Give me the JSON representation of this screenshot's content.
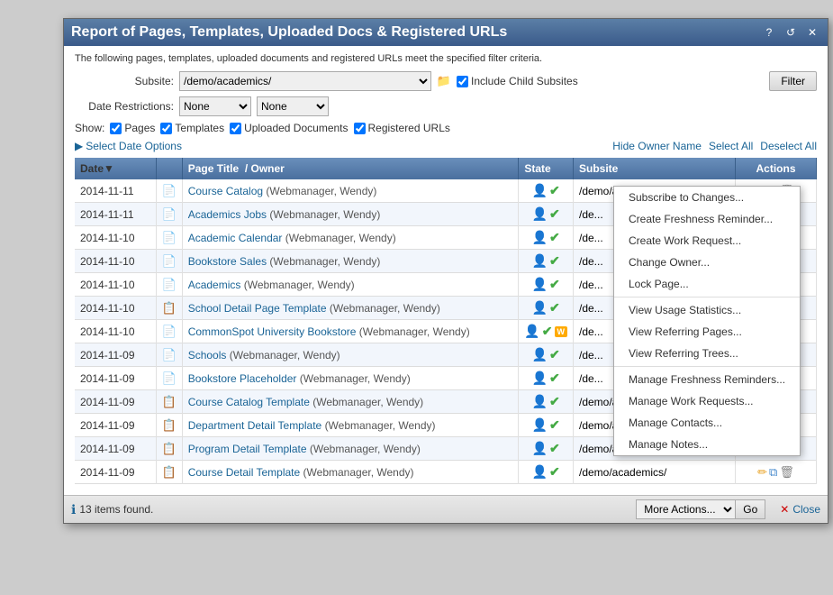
{
  "dialog": {
    "title": "Report of Pages, Templates, Uploaded Docs & Registered URLs",
    "subtitle": "The following pages, templates, uploaded documents and registered URLs meet the specified filter criteria.",
    "controls": {
      "help": "?",
      "refresh": "↺",
      "close": "✕"
    }
  },
  "form": {
    "subsite_label": "Subsite:",
    "subsite_value": "/demo/academics/",
    "date_restrictions_label": "Date Restrictions:",
    "none_option": "None",
    "include_child_subsites_label": "Include Child Subsites",
    "filter_btn": "Filter",
    "show_label": "Show:",
    "checkboxes": [
      "Pages",
      "Templates",
      "Uploaded Documents",
      "Registered URLs"
    ]
  },
  "date_options": {
    "link_text": "Select Date Options",
    "hide_owner_name": "Hide Owner Name",
    "select_all": "Select All",
    "deselect_all": "Deselect All"
  },
  "table": {
    "columns": [
      "Date▼",
      "",
      "Page Title  / Owner",
      "State",
      "Subsite",
      "Actions"
    ],
    "rows": [
      {
        "date": "2014-11-11",
        "type": "page",
        "title": "Course Catalog",
        "owner": "(Webmanager, Wendy)",
        "state_person": true,
        "state_check": true,
        "state_w": false,
        "subsite": "/demo/academics/",
        "show_actions": true,
        "show_context": true
      },
      {
        "date": "2014-11-11",
        "type": "page",
        "title": "Academics Jobs",
        "owner": "(Webmanager, Wendy)",
        "state_person": true,
        "state_check": true,
        "state_w": false,
        "subsite": "/de...",
        "show_actions": false,
        "show_context": false
      },
      {
        "date": "2014-11-10",
        "type": "page",
        "title": "Academic Calendar",
        "owner": "(Webmanager, Wendy)",
        "state_person": true,
        "state_check": true,
        "state_w": false,
        "subsite": "/de...",
        "show_actions": false,
        "show_context": false
      },
      {
        "date": "2014-11-10",
        "type": "page",
        "title": "Bookstore Sales",
        "owner": "(Webmanager, Wendy)",
        "state_person": true,
        "state_check": true,
        "state_w": false,
        "subsite": "/de...",
        "show_actions": false,
        "show_context": false
      },
      {
        "date": "2014-11-10",
        "type": "page",
        "title": "Academics",
        "owner": "(Webmanager, Wendy)",
        "state_person": true,
        "state_check": true,
        "state_w": false,
        "subsite": "/de...",
        "show_actions": false,
        "show_context": false
      },
      {
        "date": "2014-11-10",
        "type": "doc",
        "title": "School Detail Page Template",
        "owner": "(Webmanager, Wendy)",
        "state_person": true,
        "state_check": true,
        "state_w": false,
        "subsite": "/de...",
        "show_actions": false,
        "show_context": false
      },
      {
        "date": "2014-11-10",
        "type": "page",
        "title": "CommonSpot University Bookstore",
        "owner": "(Webmanager, Wendy)",
        "state_person": true,
        "state_check": true,
        "state_w": true,
        "subsite": "/de...",
        "show_actions": false,
        "show_context": false
      },
      {
        "date": "2014-11-09",
        "type": "page",
        "title": "Schools",
        "owner": "(Webmanager, Wendy)",
        "state_person": true,
        "state_check": true,
        "state_w": false,
        "subsite": "/de...",
        "show_actions": false,
        "show_context": false
      },
      {
        "date": "2014-11-09",
        "type": "page",
        "title": "Bookstore Placeholder",
        "owner": "(Webmanager, Wendy)",
        "state_person": true,
        "state_check": true,
        "state_w": false,
        "subsite": "/de...",
        "show_actions": false,
        "show_context": false
      },
      {
        "date": "2014-11-09",
        "type": "doc",
        "title": "Course Catalog Template",
        "owner": "(Webmanager, Wendy)",
        "state_person": true,
        "state_check": true,
        "state_w": false,
        "subsite": "/demo/academics/",
        "show_actions": true,
        "show_context": false
      },
      {
        "date": "2014-11-09",
        "type": "doc",
        "title": "Department Detail Template",
        "owner": "(Webmanager, Wendy)",
        "state_person": true,
        "state_check": true,
        "state_w": false,
        "subsite": "/demo/academics/",
        "show_actions": true,
        "show_context": false
      },
      {
        "date": "2014-11-09",
        "type": "doc",
        "title": "Program Detail Template",
        "owner": "(Webmanager, Wendy)",
        "state_person": true,
        "state_check": true,
        "state_w": false,
        "subsite": "/demo/academics/",
        "show_actions": true,
        "show_context": false
      },
      {
        "date": "2014-11-09",
        "type": "doc",
        "title": "Course Detail Template",
        "owner": "(Webmanager, Wendy)",
        "state_person": true,
        "state_check": true,
        "state_w": false,
        "subsite": "/demo/academics/",
        "show_actions": true,
        "show_context": false
      }
    ]
  },
  "context_menu": {
    "items": [
      "Subscribe to Changes...",
      "Create Freshness Reminder...",
      "Create Work Request...",
      "Change Owner...",
      "Lock Page...",
      "---",
      "View Usage Statistics...",
      "View Referring Pages...",
      "View Referring Trees...",
      "---",
      "Manage Freshness Reminders...",
      "Manage Work Requests...",
      "Manage Contacts...",
      "Manage Notes..."
    ]
  },
  "bottom": {
    "items_found": "13 items found.",
    "more_actions_label": "More Actions...",
    "go_label": "Go",
    "close_label": "Close"
  }
}
